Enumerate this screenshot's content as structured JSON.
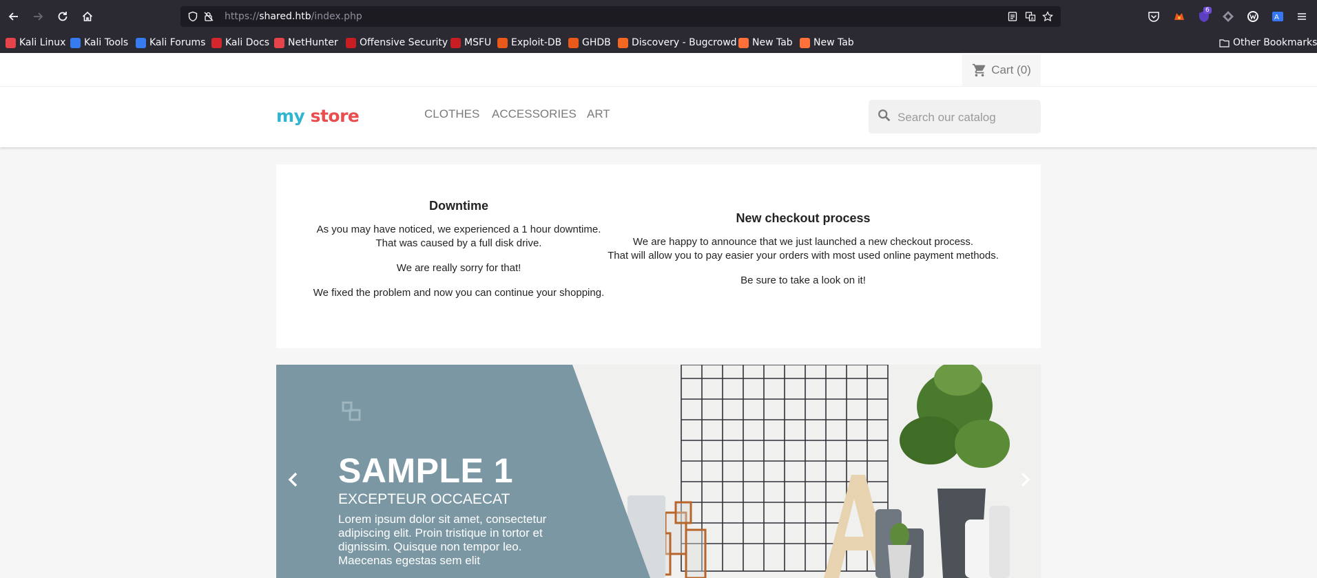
{
  "browser": {
    "url_scheme": "https://",
    "url_host": "shared.htb",
    "url_path": "/index.php",
    "notification_badge": "6",
    "bookmarks": [
      {
        "label": "Kali Linux",
        "color": "#e7434a"
      },
      {
        "label": "Kali Tools",
        "color": "#367bf0"
      },
      {
        "label": "Kali Forums",
        "color": "#367bf0"
      },
      {
        "label": "Kali Docs",
        "color": "#d3262d"
      },
      {
        "label": "NetHunter",
        "color": "#e7434a"
      },
      {
        "label": "Offensive Security",
        "color": "#c71d23"
      },
      {
        "label": "MSFU",
        "color": "#c71d23"
      },
      {
        "label": "Exploit-DB",
        "color": "#e8591a"
      },
      {
        "label": "GHDB",
        "color": "#e8591a"
      },
      {
        "label": "Discovery - Bugcrowd",
        "color": "#f26822"
      },
      {
        "label": "New Tab",
        "color": "#ff7139"
      },
      {
        "label": "New Tab",
        "color": "#ff7139"
      }
    ],
    "other_bookmarks": "Other Bookmarks"
  },
  "header": {
    "cart_label": "Cart (0)",
    "logo": {
      "word1": "my",
      "word2": "store"
    },
    "menu": [
      "Clothes",
      "Accessories",
      "Art"
    ],
    "search_placeholder": "Search our catalog"
  },
  "notice": {
    "left": {
      "title": "Downtime",
      "para1": "As you may have noticed, we experienced a 1 hour downtime.",
      "para1b": "That was caused by a full disk drive.",
      "para2": "We are really sorry for that!",
      "para3": "We fixed the problem and now you can continue your shopping."
    },
    "right": {
      "title": "New checkout process",
      "para1": "We are happy to announce that we just launched a new checkout process.",
      "para1b": "That will allow you to pay easier your orders with most used online payment methods.",
      "para2": "Be sure to take a look on it!"
    }
  },
  "slider": {
    "title": "SAMPLE 1",
    "subtitle": "EXCEPTEUR OCCAECAT",
    "text": "Lorem ipsum dolor sit amet, consectetur adipiscing elit. Proin tristique in tortor et dignissim. Quisque non tempor leo. Maecenas egestas sem elit",
    "panel_color": "#7a97a3",
    "prev_icon": "chevron-left-icon",
    "next_icon": "chevron-right-icon"
  },
  "colors": {
    "chrome_bg": "#2b2a33",
    "urlbar_bg": "#1c1b22",
    "page_bg": "#f6f6f6",
    "accent": "#24b9d7"
  }
}
